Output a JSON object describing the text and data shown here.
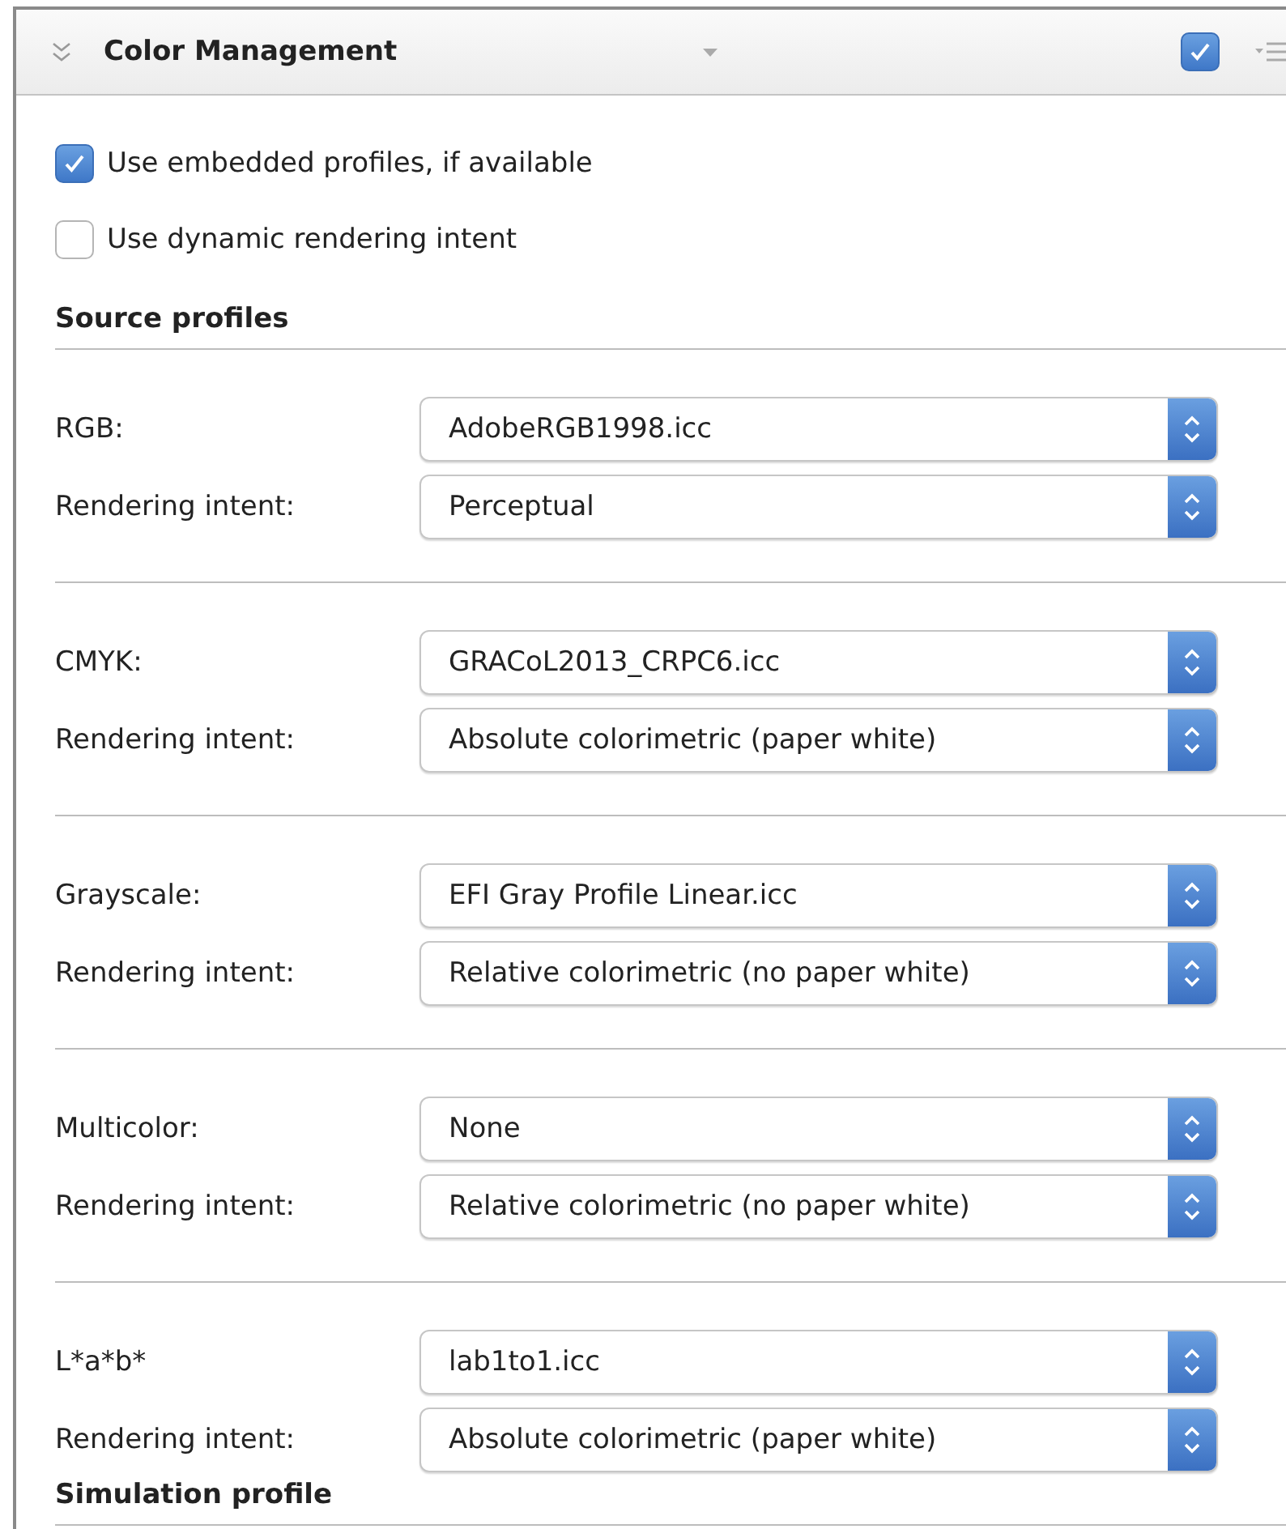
{
  "panel": {
    "title": "Color Management",
    "enabled": true
  },
  "options": [
    {
      "label": "Use embedded profiles, if available",
      "checked": true
    },
    {
      "label": "Use dynamic rendering intent",
      "checked": false
    }
  ],
  "source_profiles": {
    "heading": "Source profiles",
    "groups": [
      {
        "rows": [
          {
            "label": "RGB:",
            "value": "AdobeRGB1998.icc"
          },
          {
            "label": "Rendering intent:",
            "value": "Perceptual"
          }
        ]
      },
      {
        "rows": [
          {
            "label": "CMYK:",
            "value": "GRACoL2013_CRPC6.icc"
          },
          {
            "label": "Rendering intent:",
            "value": "Absolute colorimetric (paper white)"
          }
        ]
      },
      {
        "rows": [
          {
            "label": "Grayscale:",
            "value": "EFI Gray Profile Linear.icc"
          },
          {
            "label": "Rendering intent:",
            "value": "Relative colorimetric (no paper white)"
          }
        ]
      },
      {
        "rows": [
          {
            "label": "Multicolor:",
            "value": "None"
          },
          {
            "label": "Rendering intent:",
            "value": "Relative colorimetric (no paper white)"
          }
        ]
      },
      {
        "rows": [
          {
            "label": "L*a*b*",
            "value": "lab1to1.icc"
          },
          {
            "label": "Rendering intent:",
            "value": "Absolute colorimetric (paper white)"
          }
        ]
      }
    ]
  },
  "simulation_profile": {
    "heading": "Simulation profile"
  }
}
